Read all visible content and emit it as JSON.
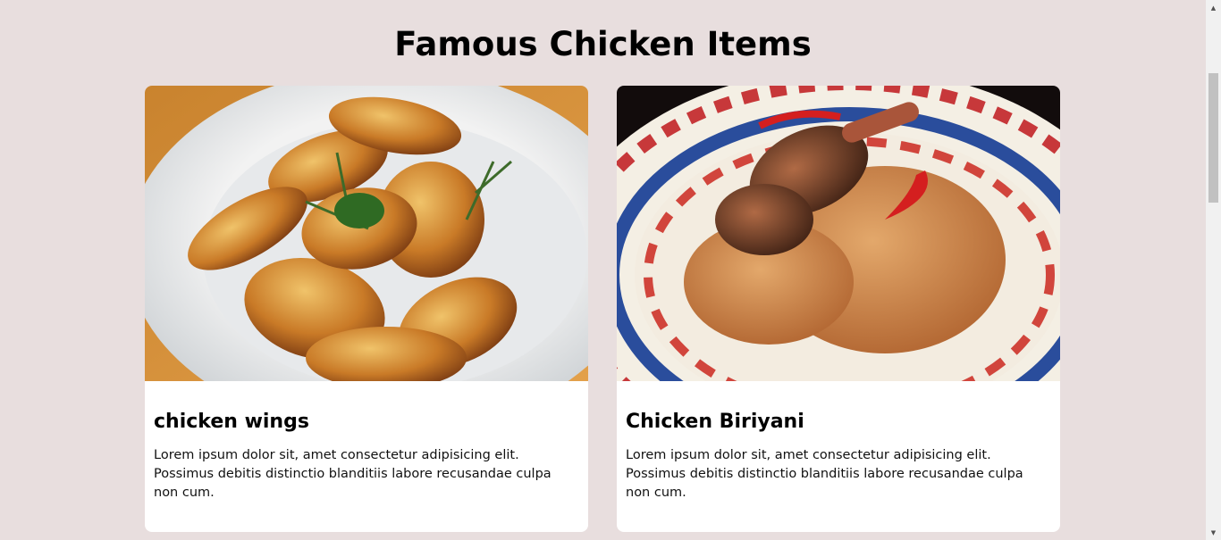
{
  "page": {
    "title": "Famous Chicken Items"
  },
  "cards": [
    {
      "title": "chicken wings",
      "text": "Lorem ipsum dolor sit, amet consectetur adipisicing elit. Possimus debitis distinctio blanditiis labore recusandae culpa non cum.",
      "image": "chicken-wings-photo"
    },
    {
      "title": "Chicken Biriyani",
      "text": "Lorem ipsum dolor sit, amet consectetur adipisicing elit. Possimus debitis distinctio blanditiis labore recusandae culpa non cum.",
      "image": "chicken-biriyani-photo"
    }
  ],
  "colors": {
    "background": "#e8dede",
    "card": "#ffffff",
    "scrollbar_track": "#f1f1f1",
    "scrollbar_thumb": "#c1c1c1"
  },
  "icons": {
    "scroll_up": "triangle-up-icon",
    "scroll_down": "triangle-down-icon"
  }
}
